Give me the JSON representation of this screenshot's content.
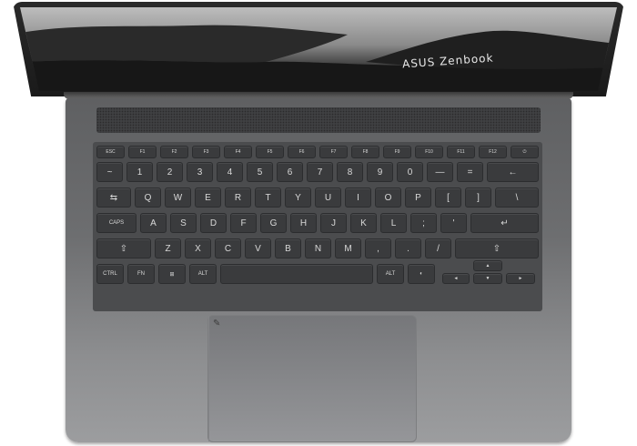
{
  "brand_text": "ASUS Zenbook",
  "function_row": [
    "ESC",
    "F1",
    "F2",
    "F3",
    "F4",
    "F5",
    "F6",
    "F7",
    "F8",
    "F9",
    "F10",
    "F11",
    "F12",
    "⏻"
  ],
  "number_row": [
    "~",
    "1",
    "2",
    "3",
    "4",
    "5",
    "6",
    "7",
    "8",
    "9",
    "0",
    "—",
    "=",
    "←"
  ],
  "qwerty_row": [
    "⇆",
    "Q",
    "W",
    "E",
    "R",
    "T",
    "Y",
    "U",
    "I",
    "O",
    "P",
    "[",
    "]",
    "\\"
  ],
  "home_row": [
    "CAPS",
    "A",
    "S",
    "D",
    "F",
    "G",
    "H",
    "J",
    "K",
    "L",
    ";",
    "'",
    "↵"
  ],
  "shift_row": [
    "⇧",
    "Z",
    "X",
    "C",
    "V",
    "B",
    "N",
    "M",
    ",",
    ".",
    "/",
    "⇧"
  ],
  "bottom_row": {
    "ctrl": "CTRL",
    "fn": "FN",
    "win": "⊞",
    "alt": "ALT",
    "alt_right": "ALT",
    "copilot": "◐"
  },
  "arrows": {
    "up": "▲",
    "left": "◄",
    "down": "▼",
    "right": "►"
  },
  "trackpad_mark": "✎"
}
